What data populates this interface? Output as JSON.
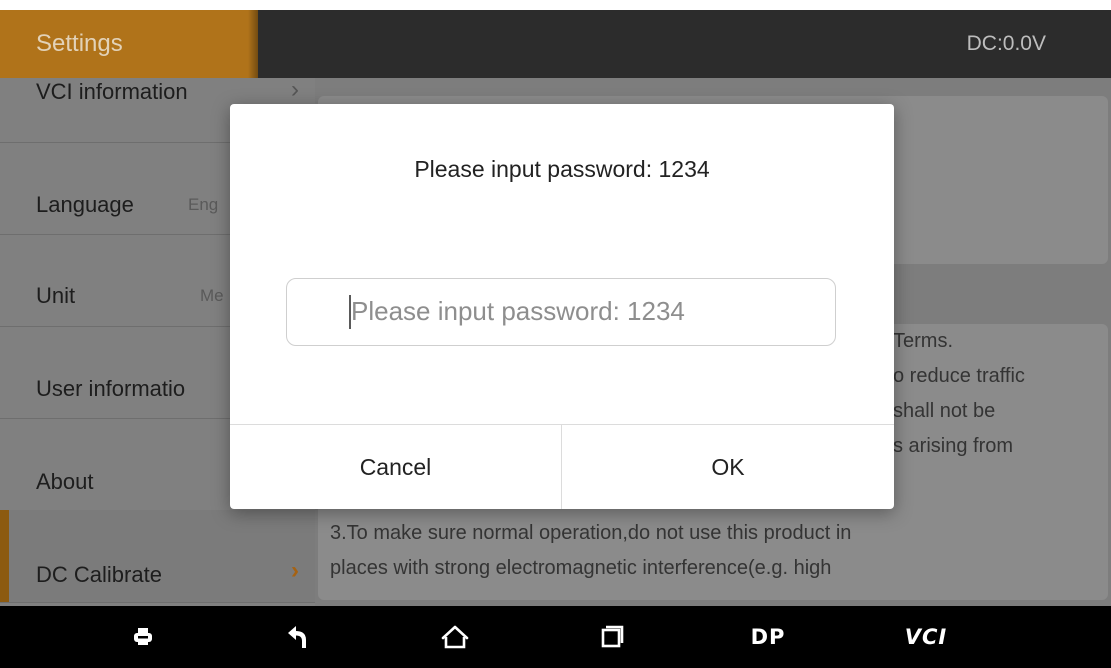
{
  "header": {
    "title": "Settings",
    "voltage": "DC:0.0V"
  },
  "sidebar": {
    "items": [
      {
        "label": "VCI information",
        "value": "",
        "chevron": "›"
      },
      {
        "label": "Language",
        "value": "Eng",
        "chevron": ""
      },
      {
        "label": "Unit",
        "value": "Me",
        "chevron": ""
      },
      {
        "label": "User informatio",
        "value": "",
        "chevron": ""
      },
      {
        "label": "About",
        "value": "",
        "chevron": ""
      },
      {
        "label": "DC Calibrate",
        "value": "",
        "chevron": "›"
      }
    ]
  },
  "content": {
    "terms_lines": [
      "Terms.",
      "o reduce traffic",
      "shall not be",
      "s arising from",
      "3.To make sure normal operation,do not use this product in",
      "places with strong electromagnetic interference(e.g. high"
    ]
  },
  "dialog": {
    "title": "Please input password: 1234",
    "input_placeholder": "Please input password: 1234",
    "cancel_label": "Cancel",
    "ok_label": "OK"
  },
  "navbar": {
    "items": [
      {
        "icon": "print-icon"
      },
      {
        "icon": "back-icon"
      },
      {
        "icon": "home-icon"
      },
      {
        "icon": "recent-apps-icon"
      },
      {
        "icon": "dp-icon",
        "label": "DP"
      },
      {
        "icon": "vci-icon",
        "label": "VCI"
      }
    ]
  }
}
